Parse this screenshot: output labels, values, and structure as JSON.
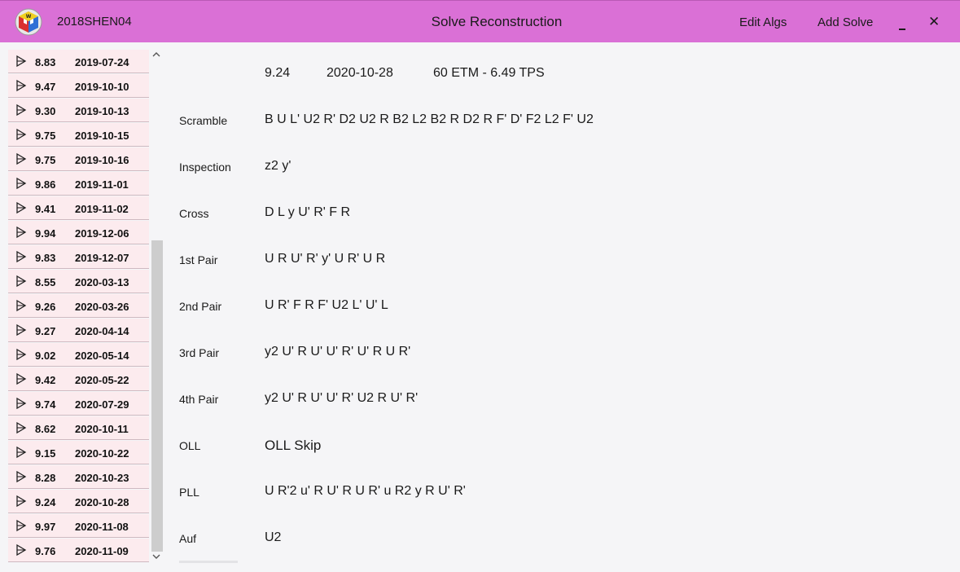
{
  "window": {
    "user": "2018SHEN04",
    "title": "Solve Reconstruction",
    "edit_algs_label": "Edit Algs",
    "add_solve_label": "Add Solve"
  },
  "sidebar": {
    "solves": [
      {
        "time": "8.83",
        "date": "2019-07-24"
      },
      {
        "time": "9.47",
        "date": "2019-10-10"
      },
      {
        "time": "9.30",
        "date": "2019-10-13"
      },
      {
        "time": "9.75",
        "date": "2019-10-15"
      },
      {
        "time": "9.75",
        "date": "2019-10-16"
      },
      {
        "time": "9.86",
        "date": "2019-11-01"
      },
      {
        "time": "9.41",
        "date": "2019-11-02"
      },
      {
        "time": "9.94",
        "date": "2019-12-06"
      },
      {
        "time": "9.83",
        "date": "2019-12-07"
      },
      {
        "time": "8.55",
        "date": "2020-03-13"
      },
      {
        "time": "9.26",
        "date": "2020-03-26"
      },
      {
        "time": "9.27",
        "date": "2020-04-14"
      },
      {
        "time": "9.02",
        "date": "2020-05-14"
      },
      {
        "time": "9.42",
        "date": "2020-05-22"
      },
      {
        "time": "9.74",
        "date": "2020-07-29"
      },
      {
        "time": "8.62",
        "date": "2020-10-11"
      },
      {
        "time": "9.15",
        "date": "2020-10-22"
      },
      {
        "time": "8.28",
        "date": "2020-10-23"
      },
      {
        "time": "9.24",
        "date": "2020-10-28"
      },
      {
        "time": "9.97",
        "date": "2020-11-08"
      },
      {
        "time": "9.76",
        "date": "2020-11-09"
      }
    ]
  },
  "solve": {
    "time": "9.24",
    "date": "2020-10-28",
    "stats": "60 ETM - 6.49 TPS",
    "steps": [
      {
        "label": "Scramble",
        "value": "B U L' U2 R' D2 U2 R B2 L2 B2 R D2 R F' D' F2 L2 F' U2"
      },
      {
        "label": "Inspection",
        "value": "z2 y'"
      },
      {
        "label": "Cross",
        "value": "D L y U' R' F R"
      },
      {
        "label": "1st Pair",
        "value": "U R U' R' y' U R' U R"
      },
      {
        "label": "2nd Pair",
        "value": "U R' F R F' U2 L' U' L"
      },
      {
        "label": "3rd Pair",
        "value": "y2 U' R U' U' R' U' R U R'"
      },
      {
        "label": "4th Pair",
        "value": "y2 U' R U' U' R' U2 R U' R'"
      },
      {
        "label": "OLL",
        "value": "OLL Skip"
      },
      {
        "label": "PLL",
        "value": "U R'2 u' R U' R U R' u R2 y R U' R'"
      },
      {
        "label": "Auf",
        "value": "U2"
      }
    ]
  },
  "colors": {
    "titlebar": "#da70d6",
    "list_row_bg": "#fcebee",
    "page_bg": "#f5f5f7"
  }
}
